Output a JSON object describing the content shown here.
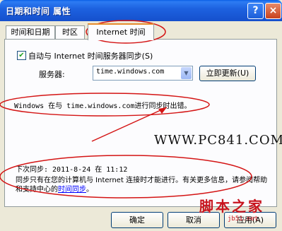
{
  "window": {
    "title": "日期和时间 属性",
    "help_glyph": "?",
    "close_glyph": "×"
  },
  "tabs": [
    {
      "label": "时间和日期"
    },
    {
      "label": "时区"
    },
    {
      "label": "Internet 时间",
      "selected": true
    }
  ],
  "sync": {
    "checkbox_label": "自动与 Internet 时间服务器同步(S)",
    "checked": true,
    "server_label": "服务器:",
    "server_value": "time.windows.com",
    "update_button": "立即更新(U)",
    "status_message": "Windows 在与 time.windows.com进行同步时出错。",
    "next_sync": "下次同步: 2011-8-24 在 11:12",
    "info_text_before": "同步只有在您的计算机与 Internet 连接时才能进行。有关更多信息，请参阅帮助和支持中心的",
    "info_link": "时间同步",
    "info_text_after": "。"
  },
  "buttons": {
    "ok": "确定",
    "cancel": "取消",
    "apply": "应用(A)"
  },
  "watermarks": {
    "site": "WWW.PC841.COM",
    "brand": "脚本之家",
    "domain": "jb51.net"
  },
  "colors": {
    "titlebar": "#1d62e0",
    "annotation_red": "#d41414",
    "link": "#0000ff"
  }
}
